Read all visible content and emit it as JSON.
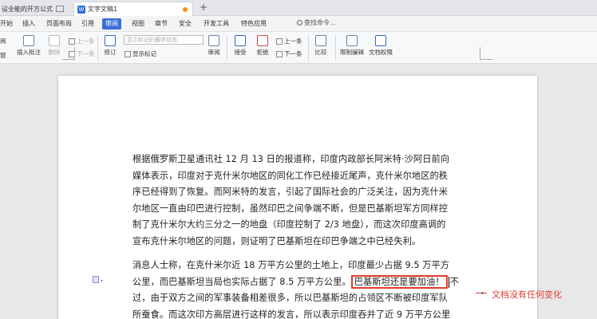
{
  "tabs": {
    "first": "设全能的开方公式",
    "doc": "文字文稿1",
    "doc_icon": "W",
    "add": "+"
  },
  "menu": {
    "items": [
      "开始",
      "插入",
      "页面布局",
      "引用",
      "审阅",
      "视图",
      "章节",
      "安全",
      "开发工具",
      "特色应用"
    ],
    "active_index": 4,
    "search": "查找命令..."
  },
  "ribbon": {
    "insert_comment": "插入批注",
    "delete": "删除",
    "prev_comment": "上一条",
    "next_comment": "下一条",
    "track": "修订",
    "markup_dropdown": "显示标记的最终状态",
    "show_markup": "显示标记",
    "review": "审阅",
    "accept": "接受",
    "reject": "拒绝",
    "prev": "上一条",
    "next": "下一条",
    "compare": "比较",
    "restrict": "限制编辑",
    "permission": "文档权限",
    "left_top": "阅",
    "left_bottom": "窗"
  },
  "document": {
    "p1_lines": [
      "根据俄罗斯卫星通讯社 12 月 13 日的报道称，印度内政部长阿米特·沙阿日前向",
      "媒体表示，印度对于克什米尔地区的同化工作已经接近尾声，克什米尔地区的秩",
      "序已经得到了恢复。而阿米特的发言，引起了国际社会的广泛关注，因为克什米",
      "尔地区一直由印巴进行控制，虽然印巴之间争端不断，但是巴基斯坦军方同样控",
      "制了克什米尔大约三分之一的地盘（印度控制了 2/3 地盘），而这次印度高调的",
      "宣布克什米尔地区的问题，则证明了巴基斯坦在印巴争端之中已经失利。"
    ],
    "p2_line1": "消息人士称，在克什米尔近 18 万平方公里的土地上，印度最少占据 9.5 万平方",
    "p2_line2_before": "公里，而巴基斯坦当局也实际占据了 8.5 万平方公里。",
    "p2_highlight": "巴基斯坦还是要加油！",
    "p2_line2_after": "不",
    "p2_line3": "过，由于双方之间的军事装备相差很多，所以巴基斯坦的占领区不断被印度军队",
    "p2_line4": "所蚕食。而这次印方高层进行这样的发言，所以表示印度吞并了近 9 万平方公里",
    "callout": "文档没有任何变化"
  }
}
